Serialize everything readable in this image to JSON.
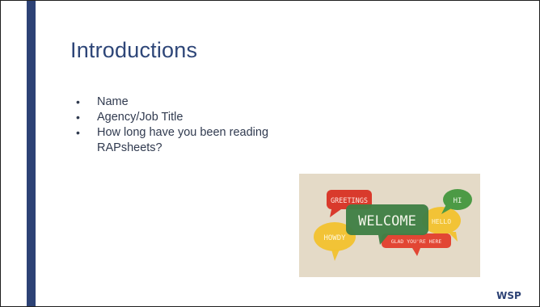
{
  "slide": {
    "title": "Introductions",
    "bullets": [
      "Name",
      "Agency/Job Title",
      "How long have you been reading RAPsheets?"
    ],
    "bullet_glyph": "•"
  },
  "image": {
    "words": {
      "greetings": "GREETINGS",
      "welcome": "WELCOME",
      "hi": "HI",
      "hello": "HELLO",
      "howdy": "HOWDY",
      "glad": "GLAD YOU'RE HERE"
    }
  },
  "logo": {
    "text": "WSP"
  },
  "colors": {
    "accent_bar": "#2d4275",
    "title": "#2e4678",
    "body_text": "#303a4f"
  }
}
